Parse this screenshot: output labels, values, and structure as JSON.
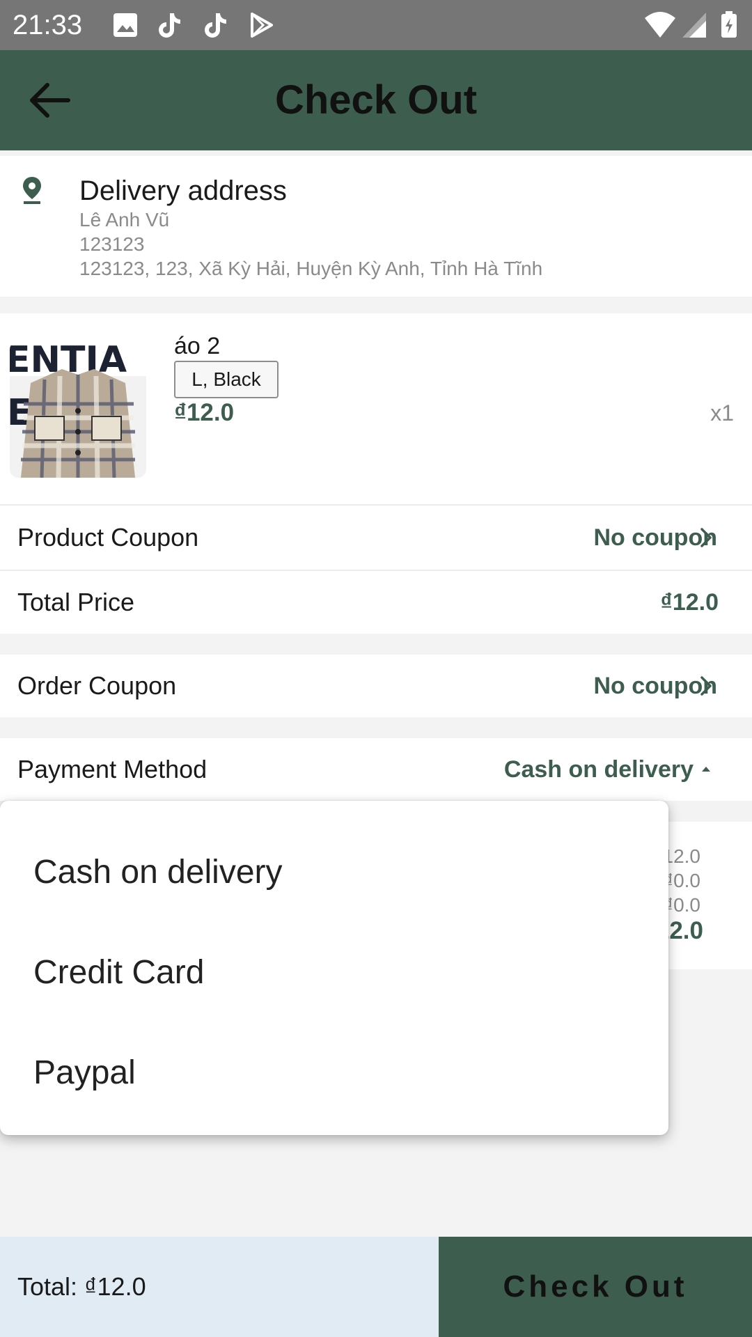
{
  "status_bar": {
    "time": "21:33"
  },
  "header": {
    "title": "Check Out"
  },
  "address": {
    "title": "Delivery address",
    "name": "Lê Anh Vũ",
    "phone": "123123",
    "full": "123123, 123, Xã Kỳ Hải, Huyện Kỳ Anh, Tỉnh Hà Tĩnh"
  },
  "product": {
    "name": "áo 2",
    "variant": "L, Black",
    "price": "₫12.0",
    "quantity": "x1"
  },
  "product_coupon": {
    "label": "Product Coupon",
    "value": "No coupon"
  },
  "total_price": {
    "label": "Total Price",
    "value": "₫12.0"
  },
  "order_coupon": {
    "label": "Order Coupon",
    "value": "No coupon"
  },
  "payment": {
    "label": "Payment Method",
    "selected": "Cash on delivery",
    "options": [
      "Cash on delivery",
      "Credit Card",
      "Paypal"
    ]
  },
  "summary_partial": {
    "line1": "12.0",
    "line2": "₫0.0",
    "line3": "₫0.0",
    "total": "12.0"
  },
  "bottom": {
    "total": "Total: ₫12.0",
    "checkout_label": "Check Out"
  },
  "colors": {
    "primary": "#3d5e4f",
    "status_bar": "#767676",
    "bottom_total_bg": "#e1ebf4"
  }
}
